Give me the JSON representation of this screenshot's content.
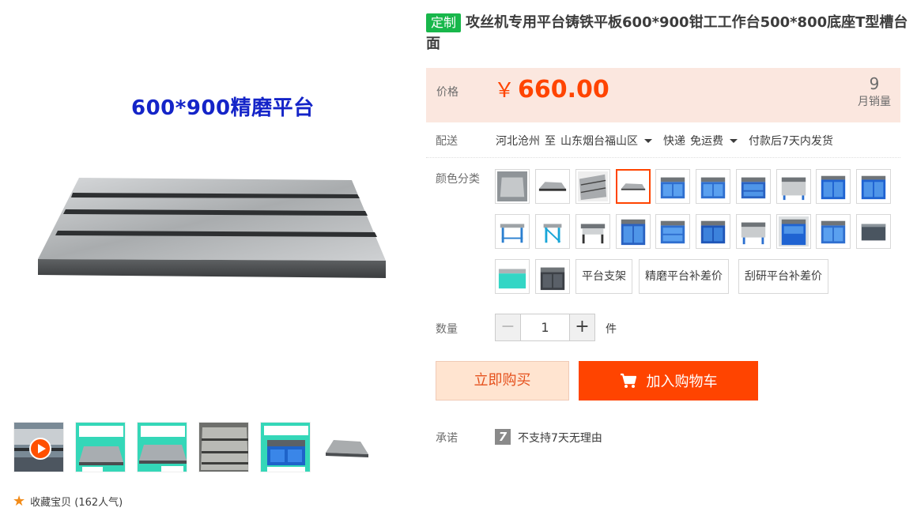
{
  "gallery": {
    "main_caption": "600*900精磨平台",
    "favorite_label": "收藏宝贝 (162人气)",
    "thumbnails": [
      {
        "type": "video",
        "icon": "play-icon"
      },
      {
        "type": "image",
        "caption": "攻丝机工作平台 T型槽精磨平台",
        "footer": "厂家直销 品质保证"
      },
      {
        "type": "image",
        "caption": "攻丝机工作平台 T型槽精磨平台",
        "footer": "厂家直销 品质保证"
      },
      {
        "type": "image",
        "caption": ""
      },
      {
        "type": "image",
        "caption": "攻丝机专用平台"
      },
      {
        "type": "image",
        "caption": ""
      }
    ]
  },
  "product": {
    "tag": "定制",
    "title": "攻丝机专用平台铸铁平板600*900钳工工作台500*800底座T型槽台面"
  },
  "price": {
    "label": "价格",
    "currency": "￥",
    "value": "660.00",
    "monthly_sales_count": "9",
    "monthly_sales_label": "月销量"
  },
  "delivery": {
    "label": "配送",
    "from": "河北沧州",
    "to_word": "至",
    "to": "山东烟台福山区",
    "method": "快递",
    "fee": "免运费",
    "ship_time": "付款后7天内发货"
  },
  "sku": {
    "label": "颜色分类",
    "selected_index": 3,
    "text_options": [
      "平台支架",
      "精磨平台补差价",
      "刮研平台补差价"
    ]
  },
  "quantity": {
    "label": "数量",
    "minus": "−",
    "plus": "+",
    "value": "1",
    "unit": "件"
  },
  "actions": {
    "buy_now": "立即购买",
    "add_to_cart": "加入购物车"
  },
  "promise": {
    "label": "承诺",
    "icon": "7",
    "text": "不支持7天无理由"
  },
  "colors": {
    "accent": "#ff4400",
    "price_bg": "#fbe7df",
    "tag_green": "#18b74b",
    "caption_blue": "#1424c8"
  }
}
